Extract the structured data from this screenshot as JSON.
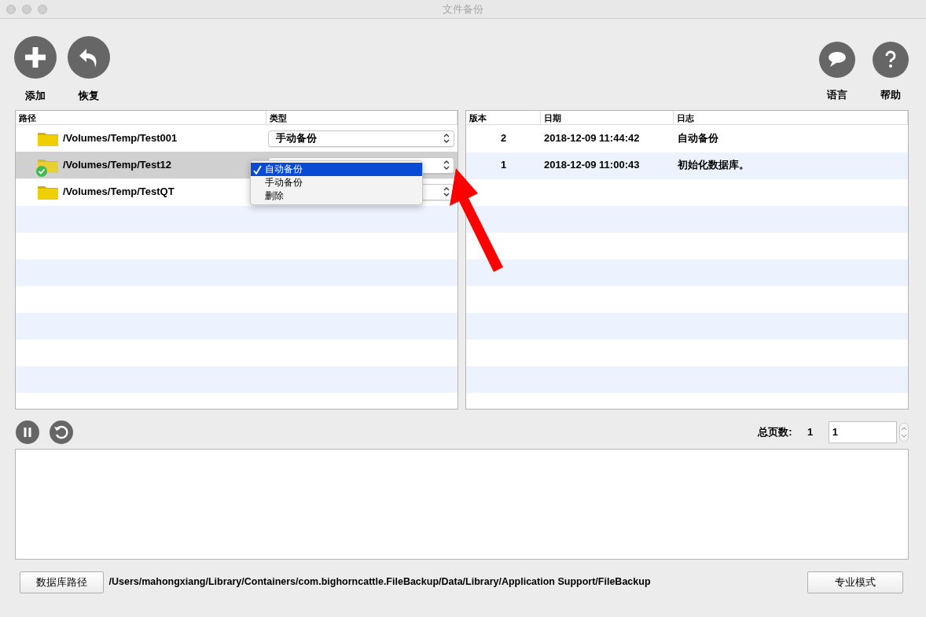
{
  "window": {
    "title": "文件备份"
  },
  "toolbar_left": [
    {
      "label": "添加",
      "kind": "add"
    },
    {
      "label": "恢复",
      "kind": "restore"
    }
  ],
  "toolbar_right": [
    {
      "label": "语言",
      "kind": "language"
    },
    {
      "label": "帮助",
      "kind": "help"
    }
  ],
  "folders": {
    "columns": [
      "路径",
      "类型"
    ],
    "rows": [
      {
        "path": "/Volumes/Temp/Test001",
        "type": "手动备份",
        "selected": false,
        "backed_up": false
      },
      {
        "path": "/Volumes/Temp/Test12",
        "selected": true,
        "backed_up": true
      },
      {
        "path": "/Volumes/Temp/TestQT",
        "selected": false,
        "backed_up": false
      }
    ]
  },
  "type_menu": {
    "options": [
      {
        "label": "自动备份",
        "selected": true
      },
      {
        "label": "手动备份",
        "selected": false
      },
      {
        "label": "删除",
        "selected": false
      }
    ]
  },
  "versions": {
    "columns": [
      "版本",
      "日期",
      "日志"
    ],
    "rows": [
      {
        "version": "2",
        "date": "2018-12-09 11:44:42",
        "log": "自动备份"
      },
      {
        "version": "1",
        "date": "2018-12-09 11:00:43",
        "log": "初始化数据库。"
      }
    ]
  },
  "pager": {
    "label": "总页数:",
    "total": "1",
    "page": "1"
  },
  "db_path": {
    "button": "数据库路径",
    "path": "/Users/mahongxiang/Library/Containers/com.bighorncattle.FileBackup/Data/Library/Application Support/FileBackup"
  },
  "mode_button": "专业模式"
}
